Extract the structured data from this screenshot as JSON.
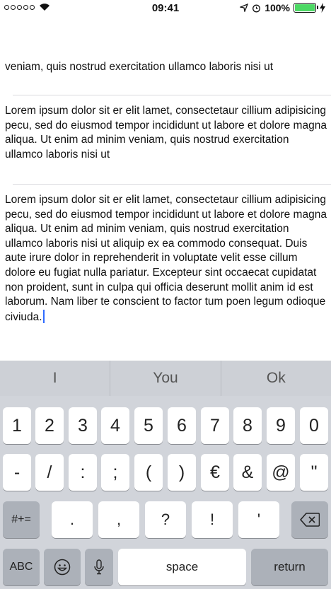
{
  "status": {
    "time": "09:41",
    "battery": "100%",
    "battery_level": 1.0
  },
  "content": {
    "partial_line": "veniam, quis nostrud exercitation ullamco laboris nisi ut",
    "paragraphs": [
      "Lorem ipsum dolor sit er elit lamet, consectetaur cillium adipisicing pecu, sed do eiusmod tempor incididunt ut labore et dolore magna aliqua. Ut enim ad minim veniam, quis nostrud exercitation ullamco laboris nisi ut",
      "Lorem ipsum dolor sit er elit lamet, consectetaur cillium adipisicing pecu, sed do eiusmod tempor incididunt ut labore et dolore magna aliqua. Ut enim ad minim veniam, quis nostrud exercitation ullamco laboris nisi ut aliquip ex ea commodo consequat. Duis aute irure dolor in reprehenderit in voluptate velit esse cillum dolore eu fugiat nulla pariatur. Excepteur sint occaecat cupidatat non proident, sunt in culpa qui officia deserunt mollit anim id est laborum. Nam liber te conscient to factor tum poen legum odioque civiuda."
    ]
  },
  "keyboard": {
    "predictions": [
      "I",
      "You",
      "Ok"
    ],
    "row1": [
      "1",
      "2",
      "3",
      "4",
      "5",
      "6",
      "7",
      "8",
      "9",
      "0"
    ],
    "row2": [
      "-",
      "/",
      ":",
      ";",
      "(",
      ")",
      "€",
      "&",
      "@",
      "\""
    ],
    "row3_mode": "#+=",
    "row3": [
      ".",
      ",",
      "?",
      "!",
      "'"
    ],
    "abc": "ABC",
    "space": "space",
    "return": "return"
  }
}
